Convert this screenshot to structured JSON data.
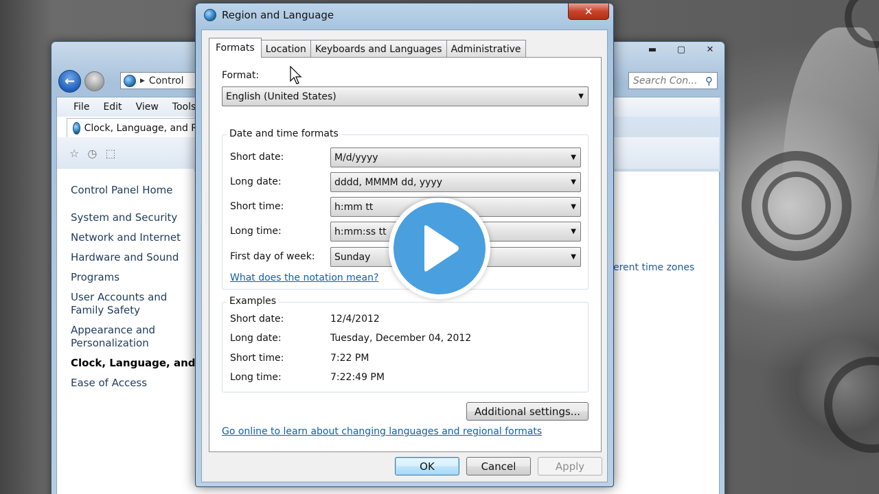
{
  "explorer": {
    "address": "Control",
    "search_placeholder": "Search Con...",
    "caption_buttons": {
      "minimize": "▬",
      "maximize": "▢",
      "close": "✕"
    },
    "menu": [
      "File",
      "Edit",
      "View",
      "Tools"
    ],
    "breadcrumb_tab": "Clock, Language, and Re",
    "sidebar": {
      "home": "Control Panel Home",
      "items": [
        "System and Security",
        "Network and Internet",
        "Hardware and Sound",
        "Programs",
        "User Accounts and Family Safety",
        "Appearance and Personalization",
        "Clock, Language, and Region",
        "Ease of Access"
      ],
      "current_index": 6
    },
    "timezones_link": "erent time zones"
  },
  "dialog": {
    "title": "Region and Language",
    "close_label": "✕",
    "tabs": [
      "Formats",
      "Location",
      "Keyboards and Languages",
      "Administrative"
    ],
    "active_tab": "Formats",
    "format_label": "Format:",
    "format_value": "English (United States)",
    "datetime_group": {
      "title": "Date and time formats",
      "rows": [
        {
          "label": "Short date:",
          "value": "M/d/yyyy"
        },
        {
          "label": "Long date:",
          "value": "dddd, MMMM dd, yyyy"
        },
        {
          "label": "Short time:",
          "value": "h:mm tt"
        },
        {
          "label": "Long time:",
          "value": "h:mm:ss tt"
        },
        {
          "label": "First day of week:",
          "value": "Sunday"
        }
      ],
      "notation_link": "What does the notation mean?"
    },
    "examples_group": {
      "title": "Examples",
      "rows": [
        {
          "label": "Short date:",
          "value": "12/4/2012"
        },
        {
          "label": "Long date:",
          "value": "Tuesday, December 04, 2012"
        },
        {
          "label": "Short time:",
          "value": "7:22 PM"
        },
        {
          "label": "Long time:",
          "value": "7:22:49 PM"
        }
      ]
    },
    "additional_settings": "Additional settings...",
    "online_link": "Go online to learn about changing languages and regional formats",
    "buttons": {
      "ok": "OK",
      "cancel": "Cancel",
      "apply": "Apply"
    }
  },
  "overlay": {
    "icon": "play-icon",
    "color": "#4a9fdf"
  }
}
